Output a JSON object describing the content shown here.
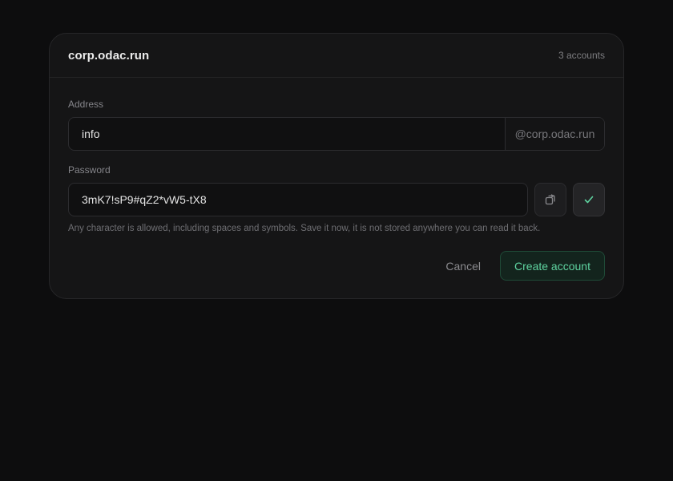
{
  "header": {
    "domain": "corp.odac.run",
    "account_count": "3 accounts"
  },
  "address": {
    "label": "Address",
    "value": "info",
    "suffix": "@corp.odac.run"
  },
  "password": {
    "label": "Password",
    "value": "3mK7!sP9#qZ2*vW5-tX8",
    "helper": "Any character is allowed, including spaces and symbols. Save it now, it is not stored anywhere you can read it back.",
    "copy_icon": "copy-icon",
    "confirm_icon": "check-icon"
  },
  "actions": {
    "cancel_label": "Cancel",
    "create_label": "Create account"
  },
  "colors": {
    "accent": "#5fd3a0",
    "background": "#0d0d0e",
    "card": "#151516"
  }
}
